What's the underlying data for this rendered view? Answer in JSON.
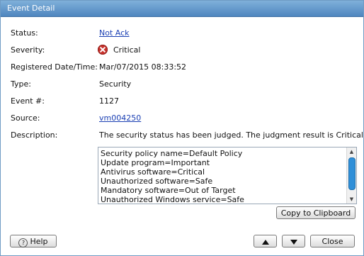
{
  "window": {
    "title": "Event Detail"
  },
  "fields": {
    "status_label": "Status:",
    "status_value": "Not Ack",
    "severity_label": "Severity:",
    "severity_value": "Critical",
    "severity_icon": "critical-x-icon",
    "registered_label": "Registered Date/Time:",
    "registered_value": "Mar/07/2015 08:33:52",
    "type_label": "Type:",
    "type_value": "Security",
    "event_label": "Event #:",
    "event_value": "1127",
    "source_label": "Source:",
    "source_value": "vm004250",
    "description_label": "Description:",
    "description_value": "The security status has been judged. The judgment result is Critical."
  },
  "details": {
    "lines": [
      "Security policy name=Default Policy",
      "Update program=Important",
      "Antivirus software=Critical",
      "Unauthorized software=Safe",
      "Mandatory software=Out of Target",
      "Unauthorized Windows service=Safe"
    ]
  },
  "buttons": {
    "copy": "Copy to Clipboard",
    "help": "Help",
    "close": "Close"
  },
  "colors": {
    "titlebar": "#5d92c9",
    "link": "#1a3fb3",
    "critical": "#c8322c",
    "scroll_thumb": "#2f8fd8"
  }
}
